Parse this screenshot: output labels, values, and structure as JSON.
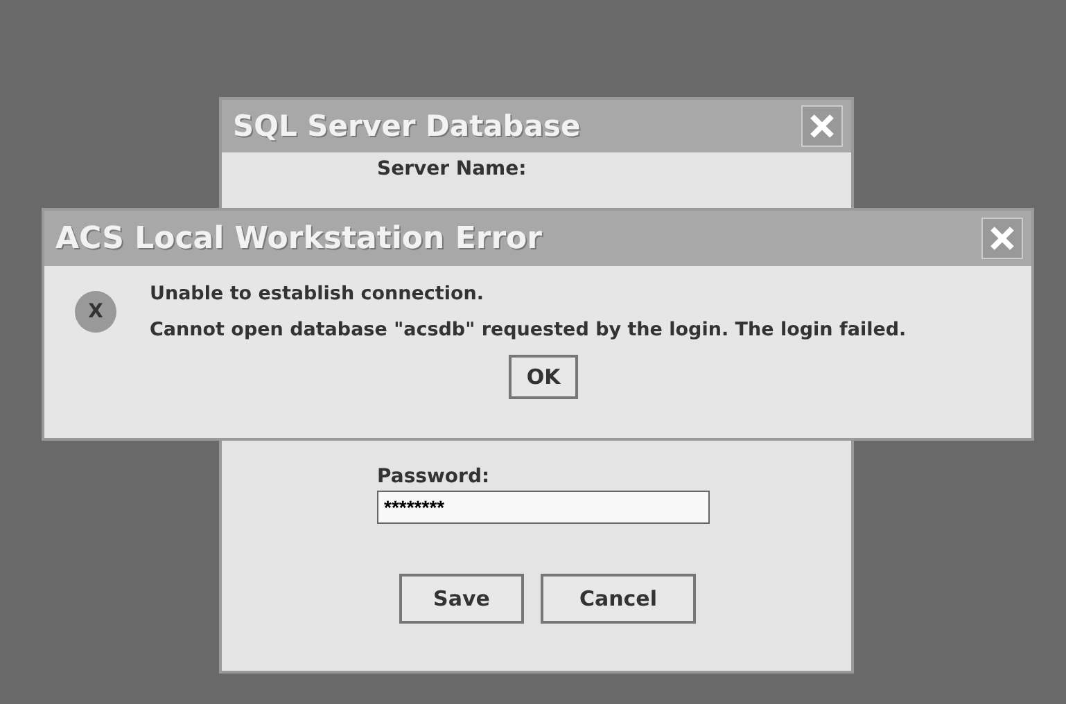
{
  "back_window": {
    "title": "SQL Server Database",
    "server_label": "Server Name:",
    "password_label": "Password:",
    "password_value": "********",
    "buttons": [
      "Save",
      "Cancel"
    ]
  },
  "error_dialog": {
    "title": "ACS Local Workstation Error",
    "icon_glyph": "X",
    "messages": [
      "Unable to establish connection.",
      "Cannot open database \"acsdb\" requested by the login. The login failed."
    ],
    "button": "OK"
  }
}
